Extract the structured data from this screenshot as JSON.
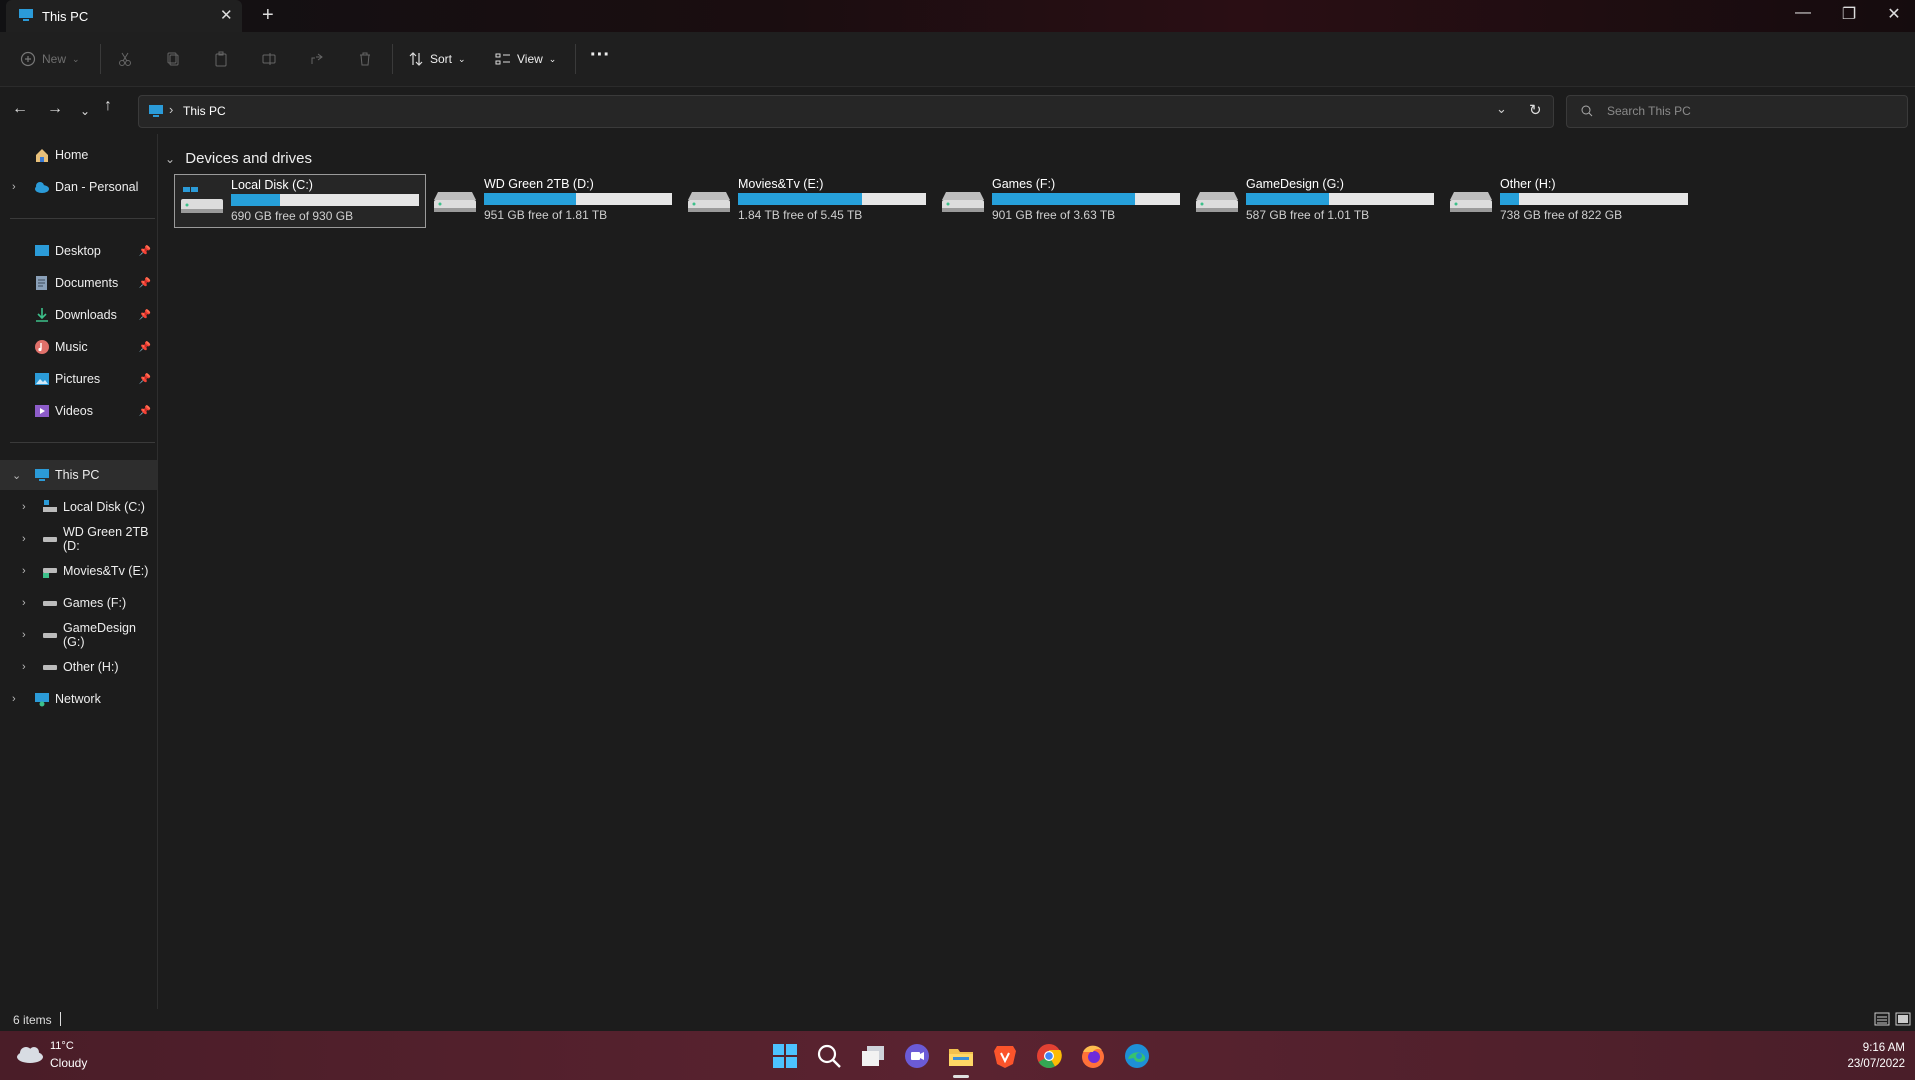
{
  "window": {
    "tab_title": "This PC",
    "tab_close": "✕",
    "new_tab": "+",
    "controls": {
      "minimize": "—",
      "maximize": "❐",
      "close": "✕"
    }
  },
  "commandbar": {
    "new_label": "New",
    "sort_label": "Sort",
    "view_label": "View",
    "more_label": "···"
  },
  "address": {
    "path": "This PC",
    "separator": "›",
    "search_placeholder": "Search This PC"
  },
  "sidebar": {
    "home": "Home",
    "onedrive": "Dan - Personal",
    "quick": [
      {
        "label": "Desktop"
      },
      {
        "label": "Documents"
      },
      {
        "label": "Downloads"
      },
      {
        "label": "Music"
      },
      {
        "label": "Pictures"
      },
      {
        "label": "Videos"
      }
    ],
    "this_pc": "This PC",
    "drives": [
      {
        "label": "Local Disk (C:)"
      },
      {
        "label": "WD Green 2TB (D:"
      },
      {
        "label": "Movies&Tv (E:)"
      },
      {
        "label": "Games (F:)"
      },
      {
        "label": "GameDesign (G:)"
      },
      {
        "label": "Other (H:)"
      }
    ],
    "network": "Network"
  },
  "main": {
    "group_title": "Devices and drives",
    "drives": [
      {
        "name": "Local Disk (C:)",
        "free": "690 GB free of 930 GB",
        "used_fraction": 0.26
      },
      {
        "name": "WD Green 2TB (D:)",
        "free": "951 GB free of 1.81 TB",
        "used_fraction": 0.49
      },
      {
        "name": "Movies&Tv (E:)",
        "free": "1.84 TB free of 5.45 TB",
        "used_fraction": 0.66
      },
      {
        "name": "Games (F:)",
        "free": "901 GB free of 3.63 TB",
        "used_fraction": 0.76
      },
      {
        "name": "GameDesign (G:)",
        "free": "587 GB free of 1.01 TB",
        "used_fraction": 0.44
      },
      {
        "name": "Other (H:)",
        "free": "738 GB free of 822 GB",
        "used_fraction": 0.1
      }
    ]
  },
  "status": {
    "items": "6 items"
  },
  "taskbar": {
    "weather_temp": "11°C",
    "weather_desc": "Cloudy",
    "time": "9:16 AM",
    "date": "23/07/2022"
  },
  "colors": {
    "accent": "#26a0da",
    "taskbar": "#5a2330",
    "background": "#1c1c1c"
  }
}
